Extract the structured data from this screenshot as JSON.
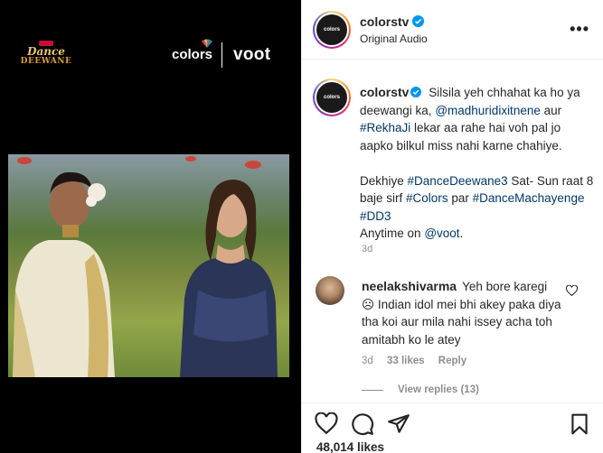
{
  "media": {
    "show_logo_line1": "Dance",
    "show_logo_line2": "DEEWANE",
    "channel_name": "colors",
    "partner_name": "voot"
  },
  "post": {
    "username": "colorstv",
    "audio_label": "Original Audio",
    "caption_line1": "Silsila yeh chhahat ka ho ya deewangi ka,",
    "mention1": "@madhuridixitnene",
    "caption_and": "aur",
    "hashtag_rekha": "#RekhaJi",
    "caption_line2": "lekar aa rahe hai voh pal jo aapko bilkul miss nahi karne chahiye.",
    "caption_dekhiye": "Dekhiye",
    "hashtag_dd3full": "#DanceDeewane3",
    "caption_satsun": "Sat- Sun raat 8 baje sirf",
    "hashtag_colors": "#Colors",
    "caption_par": "par",
    "hashtag_machayenge": "#DanceMachayenge",
    "hashtag_dd3": "#DD3",
    "caption_anytime": "Anytime on",
    "mention_voot": "@voot",
    "caption_end": ".",
    "time_ago": "3d"
  },
  "comment": {
    "username": "neelakshivarma",
    "text": "Yeh bore karegi ☹ Indian idol mei bhi akey paka diya tha koi aur mila nahi issey acha toh amitabh ko le atey",
    "time_ago": "3d",
    "likes": "33 likes",
    "reply_label": "Reply",
    "view_replies": "View replies (13)"
  },
  "footer": {
    "likes_count": "48,014 likes"
  },
  "colors": {
    "link": "#00376b",
    "muted": "#8e8e8e",
    "verified": "#0095f6"
  }
}
